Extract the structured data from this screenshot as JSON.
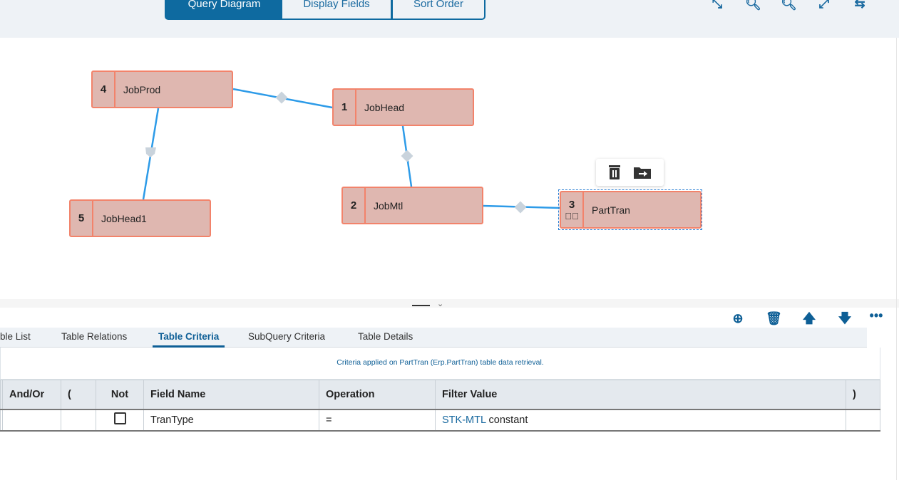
{
  "header": {
    "tabs": [
      {
        "label": "Query Diagram",
        "active": true
      },
      {
        "label": "Display Fields"
      },
      {
        "label": "Sort Order"
      }
    ],
    "tools": [
      "collapse-icon",
      "zoom-in-icon",
      "zoom-out-icon",
      "fit-icon",
      "route-icon"
    ]
  },
  "diagram": {
    "nodes": [
      {
        "num": "4",
        "name": "JobProd"
      },
      {
        "num": "1",
        "name": "JobHead"
      },
      {
        "num": "2",
        "name": "JobMtl"
      },
      {
        "num": "5",
        "name": "JobHead1"
      },
      {
        "num": "3",
        "name": "PartTran",
        "selected": true
      }
    ],
    "popup": [
      "delete-icon",
      "move-to-folder-icon"
    ]
  },
  "panel": {
    "tools": [
      "add-icon",
      "delete-icon",
      "arrow-up-icon",
      "arrow-down-icon",
      "more-icon"
    ],
    "tabs": [
      "ble List",
      "Table Relations",
      "Table Criteria",
      "SubQuery Criteria",
      "Table Details"
    ],
    "active_tab": "Table Criteria",
    "caption": "Criteria applied on PartTran (Erp.PartTran) table data retrieval.",
    "columns": [
      "And/Or",
      "(",
      "Not",
      "Field Name",
      "Operation",
      "Filter Value",
      ")"
    ],
    "rows": [
      {
        "andor": "",
        "paren": "",
        "not": false,
        "field": "TranType",
        "op": "=",
        "value": "STK-MTL",
        "value_type": "constant",
        "close": ""
      }
    ]
  }
}
